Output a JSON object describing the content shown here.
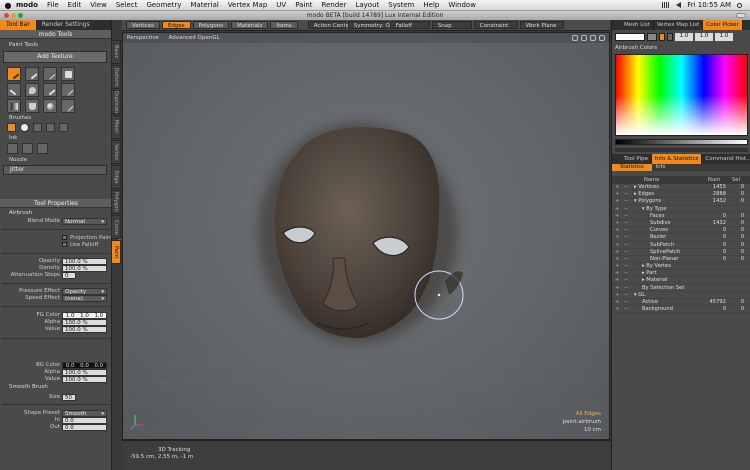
{
  "menubar": {
    "app": "modo",
    "items": [
      "File",
      "Edit",
      "View",
      "Select",
      "Geometry",
      "Material",
      "Vertex Map",
      "UV",
      "Paint",
      "Render",
      "Layout",
      "System",
      "Help",
      "Window"
    ],
    "clock": "Fri 10:55 AM"
  },
  "window": {
    "title": "modo BETA [build 14789] Lux Internal Edition"
  },
  "left": {
    "tabs": [
      "Tool Bar",
      "Render Settings"
    ],
    "panel_title": "modo Tools",
    "paint_tools_label": "Paint Tools",
    "add_texture": "Add Texture",
    "brushes_label": "Brushes",
    "ink_label": "Ink",
    "nozzle_label": "Nozzle",
    "jitter": "Jitter",
    "vtabs": [
      "Basic",
      "Deform",
      "Duplicate",
      "Mesh Edit",
      "Vertex",
      "Edge",
      "Polygon",
      "Curve",
      "Paint"
    ],
    "tool_properties": "Tool Properties",
    "airbrush": "Airbrush",
    "blend_mode_label": "Blend Mode",
    "blend_mode": "Normal",
    "projection_painting": "Projection Painting",
    "use_falloff": "Use Falloff",
    "opacity_label": "Opacity",
    "opacity": "100.0 %",
    "density_label": "Density",
    "density": "100.0 %",
    "attenuation_label": "Attenuation Steps",
    "attenuation": "0",
    "pressure_effect_label": "Pressure Effect",
    "pressure_effect": "Opacity",
    "speed_effect_label": "Speed Effect",
    "speed_effect": "(none)",
    "fg_color_label": "FG Color",
    "fg_color": [
      "1.0",
      "1.0",
      "1.0"
    ],
    "alpha_label": "Alpha",
    "fg_alpha": "100.0 %",
    "value_label": "Value",
    "fg_value": "100.0 %",
    "bg_color_label": "BG Color",
    "bg_color": [
      "0.0",
      "0.0",
      "0.0"
    ],
    "bg_alpha": "100.0 %",
    "bg_value": "100.0 %",
    "smooth_brush": "Smooth Brush",
    "size_label": "Size",
    "size": "50",
    "shape_preset_label": "Shape Preset",
    "shape_preset": "Smooth",
    "in_label": "In",
    "in": "0.0",
    "out_label": "Out",
    "out": "0.0"
  },
  "viewport": {
    "tabs": [
      "Vertices",
      "Edges",
      "Polygons",
      "Materials",
      "Items"
    ],
    "active_tab": "Edges",
    "dropdowns": [
      "Action Center",
      "Symmetry: Off",
      "Falloff",
      "Snap",
      "Constraint",
      "Work Plane"
    ],
    "header": [
      "Perspective",
      "Advanced OpenGL"
    ],
    "info": [
      "All Edges",
      "paint.airbrush",
      "10 cm"
    ],
    "status_title": "3D Tracking",
    "status_coords": "-59.5 cm, 2.55 m, -1 m"
  },
  "right": {
    "tabs": [
      "Mesh List",
      "Vertex Map List",
      "Color Picker"
    ],
    "rgb": [
      "1.0",
      "1.0",
      "1.0"
    ],
    "airbrush_colors": "Airbrush Colors",
    "info_tabs": [
      "Tool Pipe",
      "Info & Statistics",
      "Command Hist..."
    ],
    "sub_tabs": [
      "Statistics",
      "Info"
    ],
    "col_name": "Name",
    "col_num": "Num",
    "col_sel": "Sel",
    "stats": [
      {
        "name": "Vertices",
        "num": "1455",
        "sel": "0",
        "indent": 0,
        "arrow": "▸"
      },
      {
        "name": "Edges",
        "num": "2888",
        "sel": "0",
        "indent": 0,
        "arrow": "▸"
      },
      {
        "name": "Polygons",
        "num": "1432",
        "sel": "0",
        "indent": 0,
        "arrow": "▾"
      },
      {
        "name": "By Type",
        "num": "",
        "sel": "",
        "indent": 1,
        "arrow": "▾"
      },
      {
        "name": "Faces",
        "num": "0",
        "sel": "0",
        "indent": 2,
        "arrow": ""
      },
      {
        "name": "Subdivs",
        "num": "1432",
        "sel": "0",
        "indent": 2,
        "arrow": ""
      },
      {
        "name": "Curves",
        "num": "0",
        "sel": "0",
        "indent": 2,
        "arrow": ""
      },
      {
        "name": "Bezier",
        "num": "0",
        "sel": "0",
        "indent": 2,
        "arrow": ""
      },
      {
        "name": "SubPatch",
        "num": "0",
        "sel": "0",
        "indent": 2,
        "arrow": ""
      },
      {
        "name": "SplinePatch",
        "num": "0",
        "sel": "0",
        "indent": 2,
        "arrow": ""
      },
      {
        "name": "Non-Planar",
        "num": "0",
        "sel": "0",
        "indent": 2,
        "arrow": ""
      },
      {
        "name": "By Vertex",
        "num": "",
        "sel": "",
        "indent": 1,
        "arrow": "▸"
      },
      {
        "name": "Part",
        "num": "",
        "sel": "",
        "indent": 1,
        "arrow": "▸"
      },
      {
        "name": "Material",
        "num": "",
        "sel": "",
        "indent": 1,
        "arrow": "▸"
      },
      {
        "name": "By Selection Set",
        "num": "",
        "sel": "",
        "indent": 1,
        "arrow": ""
      },
      {
        "name": "GL",
        "num": "",
        "sel": "",
        "indent": 0,
        "arrow": "▾"
      },
      {
        "name": "Active",
        "num": "45792",
        "sel": "0",
        "indent": 1,
        "arrow": ""
      },
      {
        "name": "Background",
        "num": "0",
        "sel": "0",
        "indent": 1,
        "arrow": ""
      }
    ]
  }
}
